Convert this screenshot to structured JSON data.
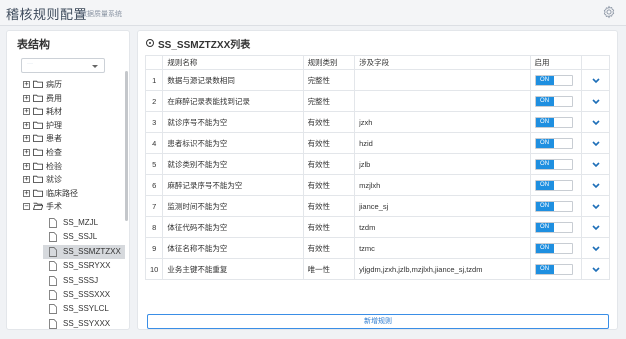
{
  "header": {
    "title": "稽核规则配置",
    "subtitle": "数据质量系统"
  },
  "left": {
    "title": "表结构",
    "select_value": "···",
    "folders": [
      {
        "label": "病历",
        "expanded": false
      },
      {
        "label": "费用",
        "expanded": false
      },
      {
        "label": "耗材",
        "expanded": false
      },
      {
        "label": "护理",
        "expanded": false
      },
      {
        "label": "患者",
        "expanded": false
      },
      {
        "label": "检查",
        "expanded": false
      },
      {
        "label": "检验",
        "expanded": false
      },
      {
        "label": "就诊",
        "expanded": false
      },
      {
        "label": "临床路径",
        "expanded": false
      },
      {
        "label": "手术",
        "expanded": true
      }
    ],
    "leaves": [
      "SS_MZJL",
      "SS_SSJL",
      "SS_SSMZTZXX",
      "SS_SSRYXX",
      "SS_SSSJ",
      "SS_SSSXXX",
      "SS_SSYLCL",
      "SS_SSYXXX"
    ]
  },
  "right": {
    "title": "SS_SSMZTZXX列表",
    "columns": [
      "规则名称",
      "规则类别",
      "涉及字段",
      "启用"
    ],
    "rows": [
      {
        "idx": "1",
        "name": "数据与源记录数相同",
        "type": "完整性",
        "field": "",
        "on": "ON"
      },
      {
        "idx": "2",
        "name": "在麻醉记录表能找到记录",
        "type": "完整性",
        "field": "",
        "on": "ON"
      },
      {
        "idx": "3",
        "name": "就诊序号不能为空",
        "type": "有效性",
        "field": "jzxh",
        "on": "ON"
      },
      {
        "idx": "4",
        "name": "患者标识不能为空",
        "type": "有效性",
        "field": "hzid",
        "on": "ON"
      },
      {
        "idx": "5",
        "name": "就诊类别不能为空",
        "type": "有效性",
        "field": "jzlb",
        "on": "ON"
      },
      {
        "idx": "6",
        "name": "麻醉记录序号不能为空",
        "type": "有效性",
        "field": "mzjlxh",
        "on": "ON"
      },
      {
        "idx": "7",
        "name": "监测时间不能为空",
        "type": "有效性",
        "field": "jiance_sj",
        "on": "ON"
      },
      {
        "idx": "8",
        "name": "体征代码不能为空",
        "type": "有效性",
        "field": "tzdm",
        "on": "ON"
      },
      {
        "idx": "9",
        "name": "体征名称不能为空",
        "type": "有效性",
        "field": "tzmc",
        "on": "ON"
      },
      {
        "idx": "10",
        "name": "业务主键不能重复",
        "type": "唯一性",
        "field": "yljgdm,jzxh,jzlb,mzjlxh,jiance_sj,tzdm",
        "on": "ON"
      }
    ],
    "add_button": "新增规则"
  },
  "colors": {
    "accent": "#1e8fe0",
    "header_bg": "#f4f5f7",
    "selected_bg": "#d6d9dd"
  }
}
